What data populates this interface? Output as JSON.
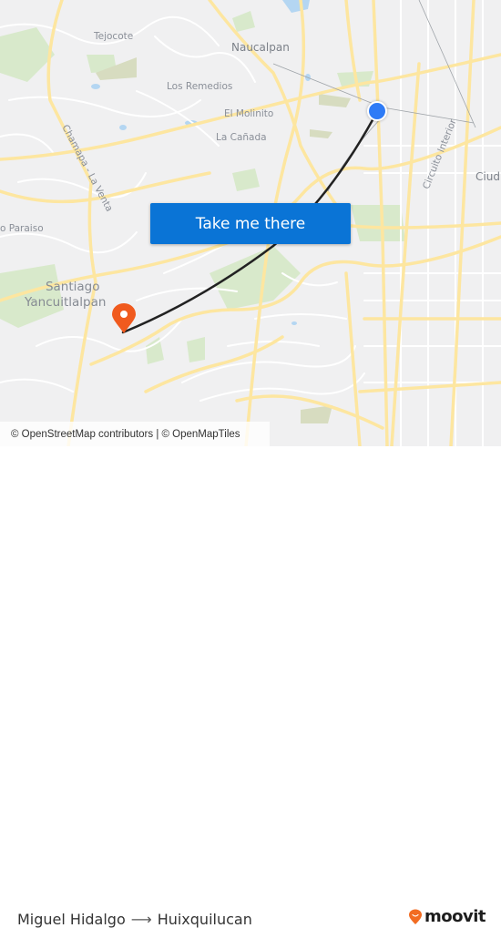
{
  "map": {
    "labels": {
      "tejocote": "Tejocote",
      "naucalpan": "Naucalpan",
      "los_remedios": "Los Remedios",
      "el_molinito": "El Molinito",
      "la_canada": "La Cañada",
      "chamapa_la_venta": "Chamapa - La Venta",
      "paraiso": "o Paraiso",
      "santiago": "Santiago",
      "yancuitlalpan": "Yancuitlalpan",
      "circuito_interior": "Circuito Interior",
      "ciudad": "Ciud"
    },
    "colors": {
      "background": "#f0f0f1",
      "major_road": "#fde9a8",
      "minor_road": "#ffffff",
      "park": "#d2e6c4",
      "water": "#a9d3f4",
      "route_line": "#222222",
      "origin_pin": "#2e7bf6",
      "destination_pin": "#f05a1e"
    },
    "origin_icon": "origin-dot-icon",
    "destination_icon": "destination-pin-icon"
  },
  "cta": {
    "label": "Take me there",
    "color": "#0a74d6"
  },
  "attribution": {
    "text": "© OpenStreetMap contributors | © OpenMapTiles"
  },
  "footer": {
    "origin": "Miguel Hidalgo",
    "arrow_icon": "arrow-right-icon",
    "destination": "Huixquilucan",
    "brand": "moovit",
    "brand_color": "#f26c22"
  }
}
